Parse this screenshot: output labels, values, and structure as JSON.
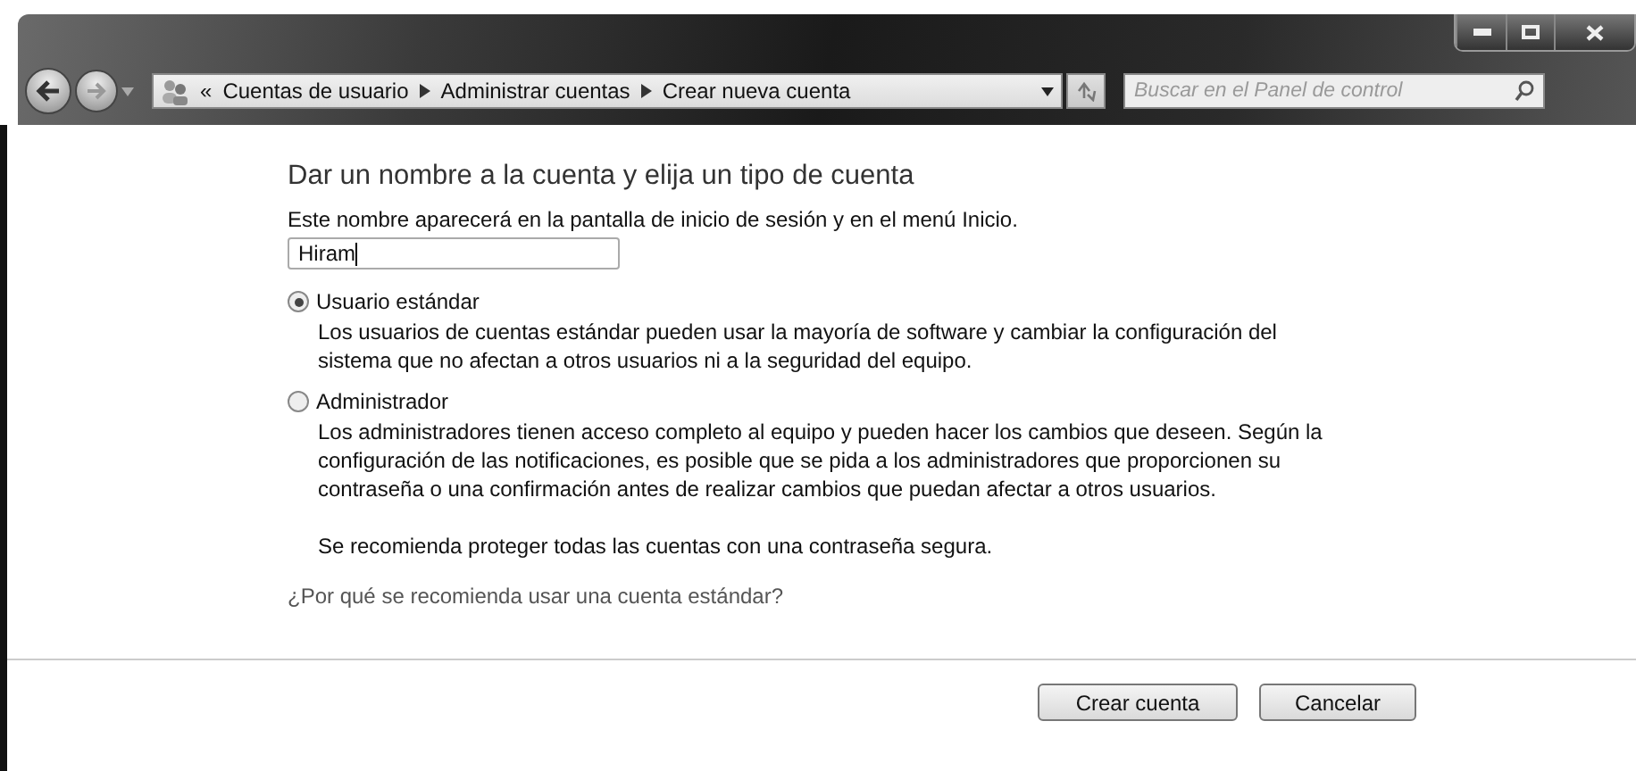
{
  "breadcrumb": {
    "overflow": "«",
    "items": [
      "Cuentas de usuario",
      "Administrar cuentas",
      "Crear nueva cuenta"
    ]
  },
  "search": {
    "placeholder": "Buscar en el Panel de control"
  },
  "heading": "Dar un nombre a la cuenta y elija un tipo de cuenta",
  "name_field": {
    "label": "Este nombre aparecerá en la pantalla de inicio de sesión y en el menú Inicio.",
    "value": "Hiram"
  },
  "account_types": [
    {
      "label": "Usuario estándar",
      "selected": true,
      "description": [
        "Los usuarios de cuentas estándar pueden usar la mayoría de software y cambiar la configuración del sistema que no afectan a otros usuarios ni a la seguridad del equipo."
      ]
    },
    {
      "label": "Administrador",
      "selected": false,
      "description": [
        "Los administradores tienen acceso completo al equipo y pueden hacer los cambios que deseen. Según la configuración de las notificaciones, es posible que se pida a los administradores que proporcionen su contraseña o una confirmación antes de realizar cambios que puedan afectar a otros usuarios.",
        "Se recomienda proteger todas las cuentas con una contraseña segura."
      ]
    }
  ],
  "help_link": "¿Por qué se recomienda usar una cuenta estándar?",
  "buttons": [
    "Crear cuenta",
    "Cancelar"
  ]
}
